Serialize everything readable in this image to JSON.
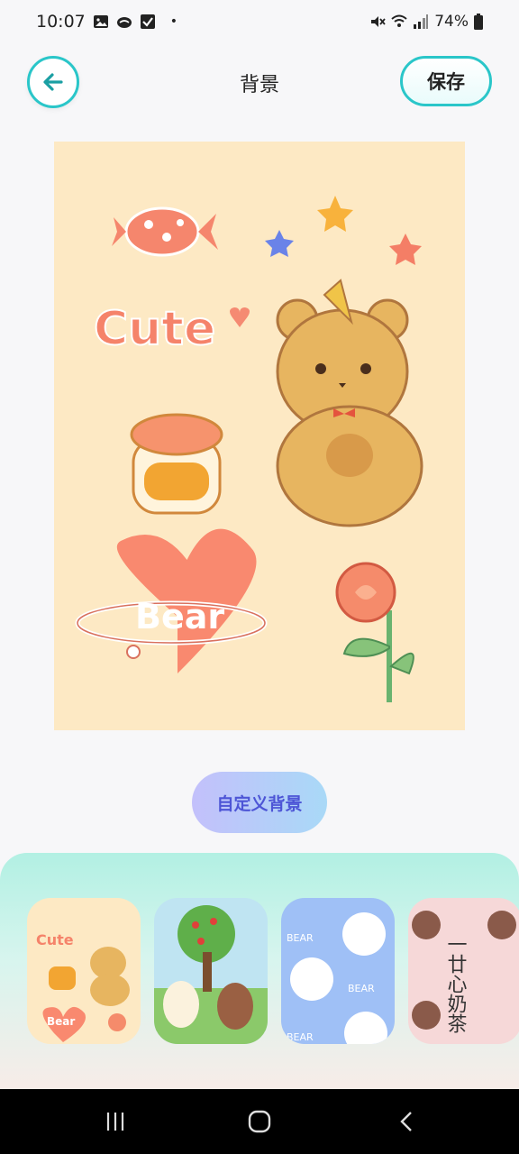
{
  "status": {
    "time": "10:07",
    "battery": "74%",
    "dot": "•"
  },
  "header": {
    "title": "背景",
    "save_label": "保存"
  },
  "preview": {
    "cute_text": "Cute",
    "bear_text": "Bear"
  },
  "custom_button": {
    "label": "自定义背景"
  },
  "thumbnails": [
    {
      "cute": "Cute",
      "bear": "Bear"
    },
    {},
    {
      "t1": "BEAR",
      "t2": "BEAR",
      "t3": "BEAR"
    },
    {
      "text": "一廿心奶茶"
    }
  ],
  "colors": {
    "accent": "#2ac6c9",
    "custom_button_text": "#4d55d6",
    "preview_bg": "#fde9c4"
  }
}
